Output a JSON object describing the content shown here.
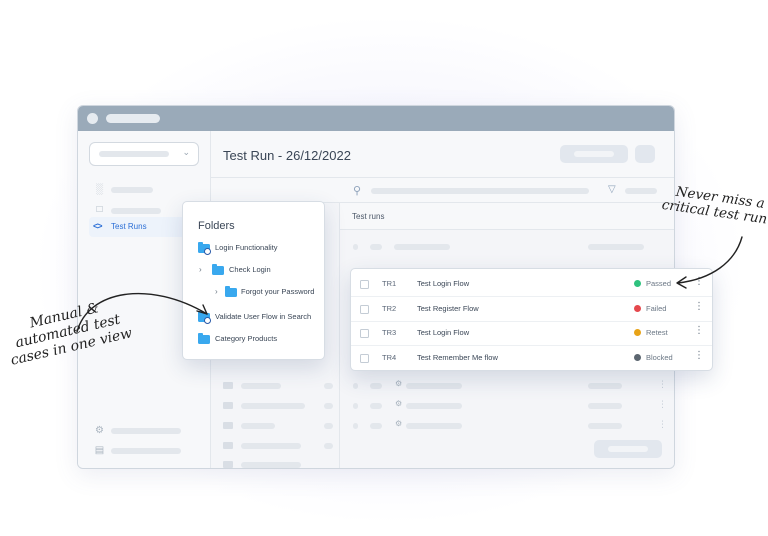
{
  "header": {
    "title": "Test Run - 26/12/2022"
  },
  "sidebar": {
    "active_item_label": "Test Runs",
    "active_item_icon": "code-icon"
  },
  "main": {
    "section_title": "Test runs"
  },
  "folders_panel": {
    "title": "Folders",
    "items": [
      {
        "label": "Login Functionality",
        "icon": "folder-gear-icon"
      },
      {
        "label": "Check Login",
        "icon": "folder-icon",
        "expandable": true
      },
      {
        "label": "Forgot your Password",
        "icon": "folder-icon",
        "expandable": true
      },
      {
        "label": "Validate User Flow in Search",
        "icon": "folder-gear-icon"
      },
      {
        "label": "Category Products",
        "icon": "folder-icon"
      }
    ]
  },
  "test_runs": [
    {
      "id": "TR1",
      "name": "Test Login Flow",
      "status": "Passed",
      "status_color": "#2ec27e"
    },
    {
      "id": "TR2",
      "name": "Test Register Flow",
      "status": "Failed",
      "status_color": "#e5484d"
    },
    {
      "id": "TR3",
      "name": "Test Login Flow",
      "status": "Retest",
      "status_color": "#e8a317"
    },
    {
      "id": "TR4",
      "name": "Test Remember Me flow",
      "status": "Blocked",
      "status_color": "#5c6670"
    }
  ],
  "annotations": {
    "right": [
      "Never miss a",
      "critical test run"
    ],
    "left": [
      "Manual &",
      "automated test",
      "cases in one view"
    ]
  },
  "colors": {
    "accent": "#2c6fd6",
    "folder": "#39a8ee",
    "titlebar": "#9aaab9"
  }
}
